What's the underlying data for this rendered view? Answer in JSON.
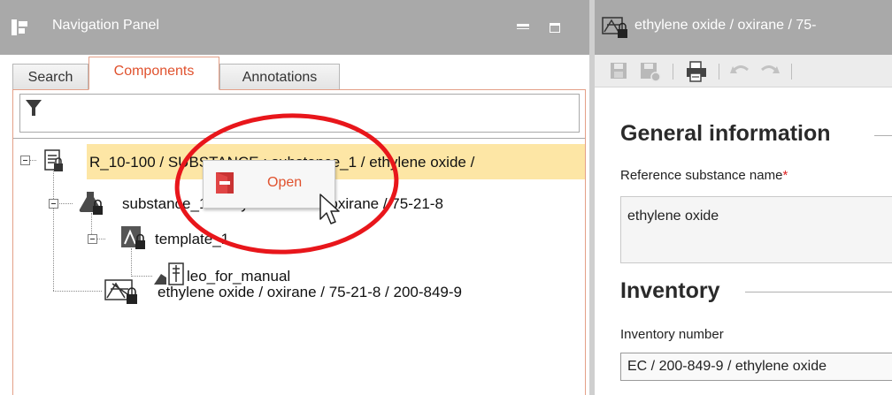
{
  "navigation_panel": {
    "title": "Navigation Panel",
    "tabs": [
      {
        "label": "Search",
        "active": false
      },
      {
        "label": "Components",
        "active": true
      },
      {
        "label": "Annotations",
        "active": false
      }
    ],
    "filter_icon": "filter-funnel-icon",
    "tree": [
      {
        "label": "R_10-100 / SUBSTANCE : substance_1 / ethylene oxide /",
        "icon": "dossier-lock-icon",
        "selected": true
      },
      {
        "label": "substance_1 / ethylene oxide / oxirane / 75-21-8",
        "icon": "flask-lock-icon",
        "selected": false
      },
      {
        "label": "template_1",
        "icon": "template-lock-icon",
        "selected": false
      },
      {
        "label": "leo_for_manual",
        "icon": "legal-entity-icon",
        "selected": false
      },
      {
        "label": "ethylene oxide / oxirane / 75-21-8 / 200-849-9",
        "icon": "reference-substance-lock-icon",
        "selected": false
      }
    ]
  },
  "context_menu": {
    "items": [
      {
        "label": "Open",
        "icon": "open-document-icon"
      }
    ]
  },
  "editor_panel": {
    "title": "ethylene oxide / oxirane / 75-",
    "toolbar": [
      "save-icon",
      "save-disabled-icon",
      "print-icon",
      "undo-icon",
      "redo-icon"
    ],
    "sections": {
      "general_information": {
        "title": "General information",
        "reference_substance_name_label": "Reference substance name",
        "required_marker": "*",
        "reference_substance_name_value": "ethylene oxide"
      },
      "inventory": {
        "title": "Inventory",
        "inventory_number_label": "Inventory number",
        "inventory_number_value": "EC / 200-849-9 / ethylene oxide"
      }
    }
  },
  "colors": {
    "titlebar": "#a9a9a9",
    "active_tab_text": "#e0522e",
    "selection_highlight": "#fde6a5",
    "annotation_ellipse": "#e8161b",
    "required_asterisk": "#dd2222"
  }
}
